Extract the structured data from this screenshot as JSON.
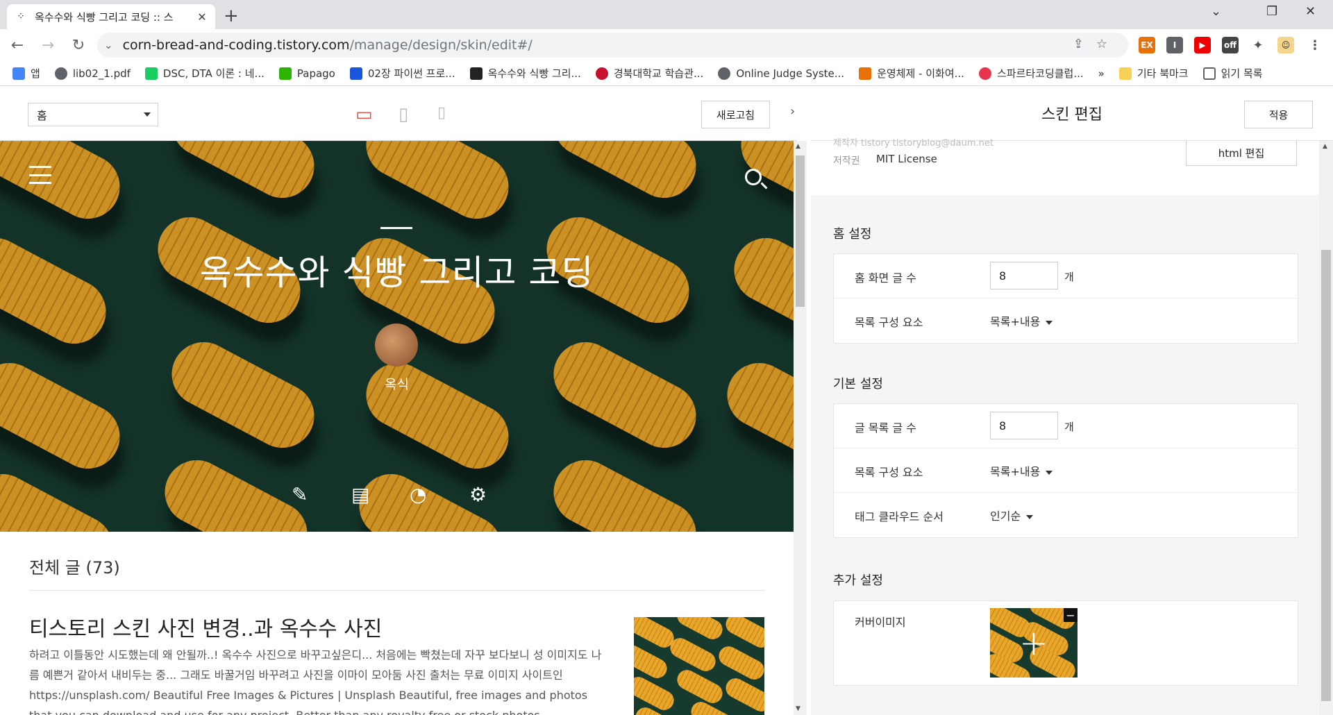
{
  "browser": {
    "tab_title": "옥수수와 식빵 그리고 코딩 :: 스",
    "tab_close": "✕",
    "new_tab": "+",
    "url_host": "corn-bread-and-coding.tistory.com",
    "url_path": "/manage/design/skin/edit#/",
    "window_minimize": "⌄",
    "window_restore": "❐",
    "window_close": "✕"
  },
  "bookmarks": [
    {
      "label": "앱",
      "color": "#4285f4"
    },
    {
      "label": "lib02_1.pdf",
      "color": "#5f6368"
    },
    {
      "label": "DSC, DTA 이론 : 네...",
      "color": "#19ce60"
    },
    {
      "label": "Papago",
      "color": "#2db400"
    },
    {
      "label": "02장 파이썬 프로...",
      "color": "#1a56db"
    },
    {
      "label": "옥수수와 식빵 그리...",
      "color": "#222222"
    },
    {
      "label": "경북대학교 학습관...",
      "color": "#c8102e"
    },
    {
      "label": "Online Judge Syste...",
      "color": "#5f6368"
    },
    {
      "label": "운영체제 - 이화여...",
      "color": "#e8710a"
    },
    {
      "label": "스파르타코딩클럽...",
      "color": "#e8344e"
    }
  ],
  "bookmarks_more": "»",
  "bookmarks_other": "기타 북마크",
  "bookmarks_reading": "읽기 목록",
  "editor": {
    "page_select": "홈",
    "refresh": "새로고침",
    "panel_title": "스킨 편집",
    "apply": "적용",
    "html_edit": "html 편집",
    "faded_text": "제작자    tistory  tistoryblog@daum.net",
    "license_label": "저작권",
    "license_value": "MIT License"
  },
  "blog": {
    "title": "옥수수와 식빵 그리고 코딩",
    "nickname": "옥식",
    "total": "전체 글 (73)",
    "post_title": "티스토리 스킨 사진 변경..과 옥수수 사진",
    "post_excerpt": "하려고 이틀동안 시도했는데 왜 안될까..! 옥수수 사진으로 바꾸고싶은디... 처음에는 빡쳤는데 자꾸 보다보니 성 이미지도 나름 예쁜거 같아서 내비두는 중... 그래도 바꿀거임 바꾸려고 사진을 이마이 모아둠 사진 출처는 무료 이미지 사이트인 https://unsplash.com/ Beautiful Free Images & Pictures | Unsplash Beautiful, free images and photos that you can download and use for any project. Better than any royalty free or stock photos. unsplash.com"
  },
  "settings": {
    "home": {
      "title": "홈 설정",
      "post_count_label": "홈 화면 글 수",
      "post_count_value": "8",
      "unit": "개",
      "list_label": "목록 구성 요소",
      "list_value": "목록+내용"
    },
    "basic": {
      "title": "기본 설정",
      "post_count_label": "글 목록 글 수",
      "post_count_value": "8",
      "unit": "개",
      "list_label": "목록 구성 요소",
      "list_value": "목록+내용",
      "tag_label": "태그 클라우드 순서",
      "tag_value": "인기순"
    },
    "extra": {
      "title": "추가 설정",
      "cover_label": "커버이미지",
      "plus": "+",
      "minus": "−"
    }
  }
}
